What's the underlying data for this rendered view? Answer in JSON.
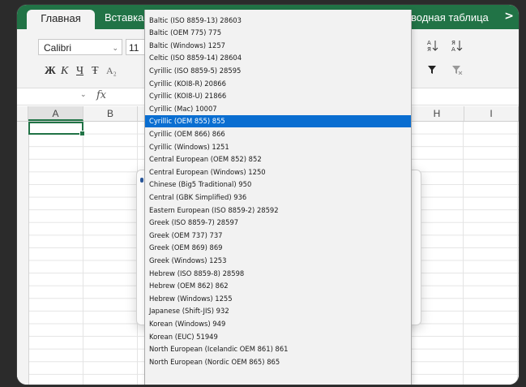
{
  "ribbon": {
    "tabs": [
      "Главная",
      "Вставка",
      "водная таблица"
    ],
    "next_arrow": ">",
    "font_name": "Calibri",
    "font_size": "11",
    "format_buttons": [
      "Ж",
      "К",
      "Ч",
      "Ŧ",
      "A₂"
    ],
    "sort_asc_icon": "sort-asc-icon",
    "sort_desc_icon": "sort-desc-icon",
    "filter_icon": "filter-icon",
    "clear_filter_icon": "clear-filter-icon"
  },
  "formula_bar": {
    "fx": "fx"
  },
  "grid": {
    "columns": [
      "A",
      "B",
      "H",
      "I"
    ],
    "selected_column": "A"
  },
  "encoding_list": {
    "selected": "Cyrillic (OEM 855) 855",
    "options": [
      "Baltic (ISO 8859-13) 28603",
      "Baltic (OEM 775) 775",
      "Baltic (Windows) 1257",
      "Celtic (ISO 8859-14) 28604",
      "Cyrillic (ISO 8859-5) 28595",
      "Cyrillic (KOI8-R) 20866",
      "Cyrillic (KOI8-U) 21866",
      "Cyrillic (Mac) 10007",
      "Cyrillic (OEM 855) 855",
      "Cyrillic (OEM 866) 866",
      "Cyrillic (Windows) 1251",
      "Central European (OEM 852) 852",
      "Central European (Windows) 1250",
      "Chinese (Big5 Traditional) 950",
      "Central (GBK Simplified) 936",
      "Eastern European (ISO 8859-2) 28592",
      "Greek (ISO 8859-7) 28597",
      "Greek (OEM 737) 737",
      "Greek (OEM 869) 869",
      "Greek (Windows) 1253",
      "Hebrew (ISO 8859-8) 28598",
      "Hebrew (OEM 862) 862",
      "Hebrew (Windows) 1255",
      "Japanese (Shift-JIS) 932",
      "Korean (Windows) 949",
      "Korean (EUC) 51949",
      "North European (Icelandic OEM 861) 861",
      "North European (Nordic OEM 865) 865"
    ]
  }
}
